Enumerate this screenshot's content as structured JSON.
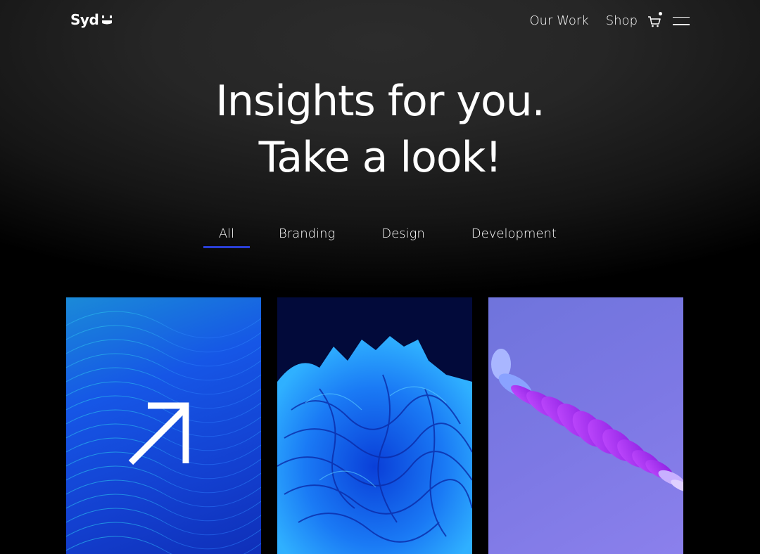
{
  "header": {
    "logo_text": "Syd",
    "nav": [
      {
        "label": "Our Work"
      },
      {
        "label": "Shop"
      }
    ],
    "cart_icon": "cart-icon",
    "menu_icon": "hamburger-menu-icon"
  },
  "hero": {
    "line1": "Insights for you.",
    "line2": "Take a look!"
  },
  "filters": {
    "items": [
      {
        "label": "All",
        "active": true
      },
      {
        "label": "Branding",
        "active": false
      },
      {
        "label": "Design",
        "active": false
      },
      {
        "label": "Development",
        "active": false
      }
    ],
    "accent_color": "#2a3fd6"
  },
  "cards": [
    {
      "image": "blue wave lines with arrow",
      "overlay_icon": "arrow-up-right-icon"
    },
    {
      "image": "blue abstract 3D layered shape"
    },
    {
      "image": "purple spiral discs on lavender"
    }
  ]
}
